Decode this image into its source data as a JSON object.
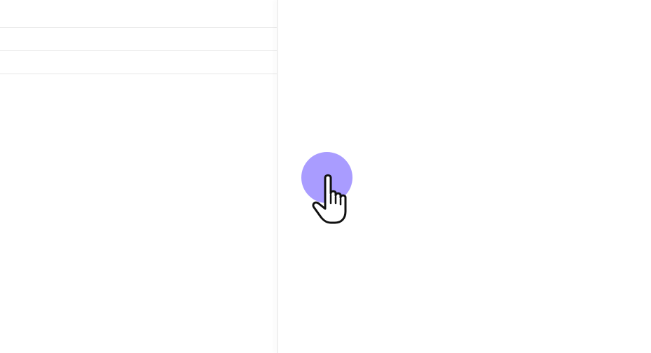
{
  "list": {
    "rows": [
      "",
      "",
      ""
    ]
  },
  "cursor": {
    "icon": "pointing-hand-icon",
    "indicator_color": "#a99cff"
  }
}
